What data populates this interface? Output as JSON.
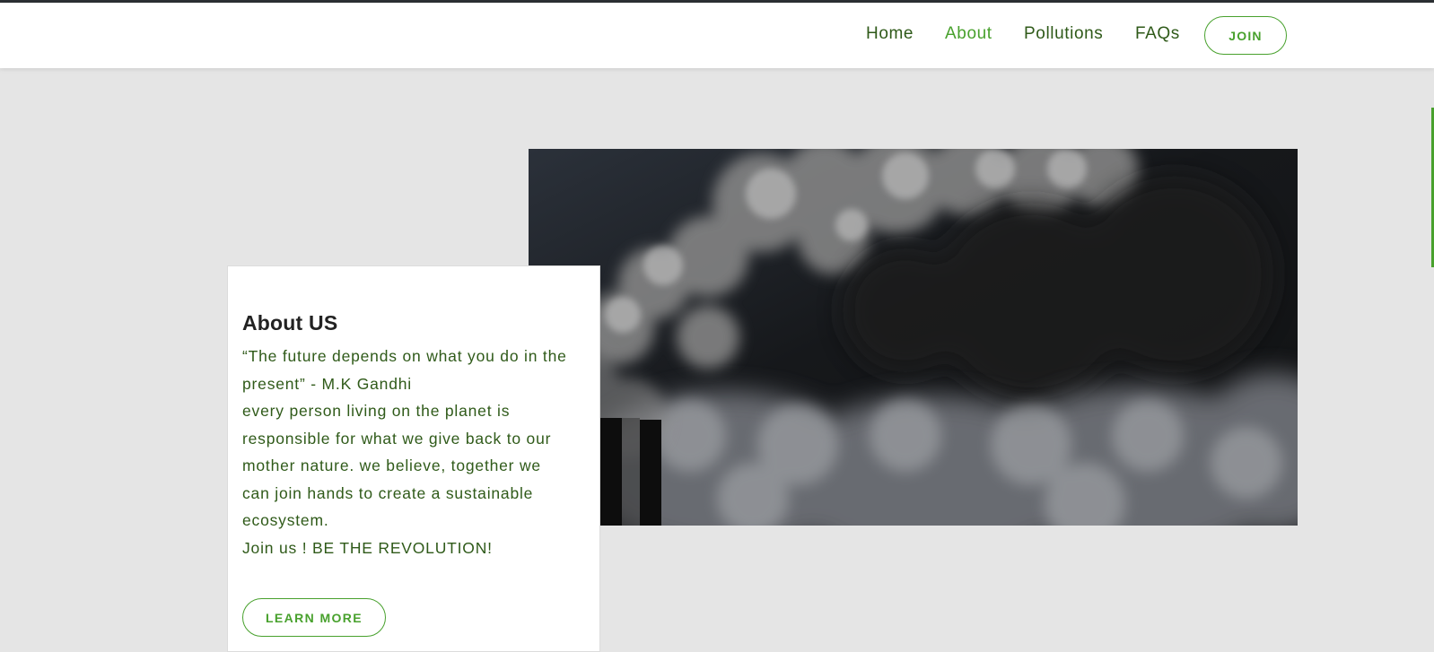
{
  "nav": {
    "items": [
      {
        "label": "Home"
      },
      {
        "label": "About"
      },
      {
        "label": "Pollutions"
      },
      {
        "label": "FAQs"
      }
    ],
    "active": "About",
    "join_label": "JOIN"
  },
  "hero": {
    "image": "factory-smoke-image"
  },
  "about": {
    "title": "About US",
    "quote_line1": "“The future depends on what you do in the",
    "quote_line2": "present” - M.K Gandhi",
    "body1": "every person living on the planet is",
    "body2": "responsible for what we give back to our",
    "body3": "mother nature. we believe, together we",
    "body4": "can join hands to create a sustainable",
    "body5": "ecosystem.",
    "cta": "Join us ! BE THE REVOLUTION!",
    "button_label": "LEARN MORE"
  },
  "colors": {
    "accent": "#48a12d",
    "text_green": "#2f5a19",
    "background": "#e5e5e5"
  }
}
